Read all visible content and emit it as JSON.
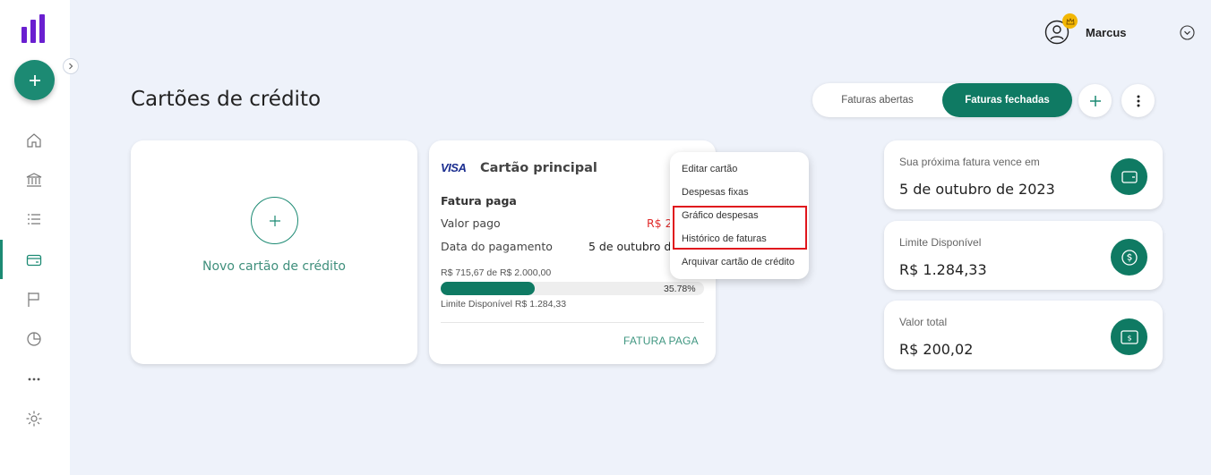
{
  "app": {
    "user_name": "Marcus",
    "page_title": "Cartões de crédito",
    "accent_color": "#0f7a63",
    "brand_color": "#6a1fd0"
  },
  "sidebar": {
    "items": [
      {
        "name": "home-icon"
      },
      {
        "name": "bank-icon"
      },
      {
        "name": "list-icon"
      },
      {
        "name": "credit-card-icon",
        "active": true
      },
      {
        "name": "flag-icon"
      },
      {
        "name": "pie-chart-icon"
      },
      {
        "name": "more-icon"
      },
      {
        "name": "settings-icon"
      }
    ]
  },
  "toolbar": {
    "tab_open": "Faturas abertas",
    "tab_closed": "Faturas fechadas",
    "active_tab": "Faturas fechadas"
  },
  "new_card": {
    "label": "Novo cartão de crédito"
  },
  "credit_card": {
    "brand": "VISA",
    "name": "Cartão principal",
    "status_title": "Fatura paga",
    "paid_label": "Valor pago",
    "paid_value": "R$ 200,02",
    "date_label": "Data do pagamento",
    "date_value": "5 de outubro de 2023",
    "usage_text": "R$ 715,67 de R$ 2.000,00",
    "usage_percent": 35.78,
    "usage_percent_label": "35.78%",
    "available_text": "Limite Disponível R$ 1.284,33",
    "action_label": "FATURA PAGA"
  },
  "menu": {
    "items": [
      "Editar cartão",
      "Despesas fixas",
      "Gráfico despesas",
      "Histórico de faturas",
      "Arquivar cartão de crédito"
    ]
  },
  "info_cards": [
    {
      "label": "Sua próxima fatura vence em",
      "value": "5 de outubro de 2023",
      "icon": "wallet-icon"
    },
    {
      "label": "Limite Disponível",
      "value": "R$ 1.284,33",
      "icon": "coin-icon"
    },
    {
      "label": "Valor total",
      "value": "R$ 200,02",
      "icon": "cash-icon"
    }
  ]
}
